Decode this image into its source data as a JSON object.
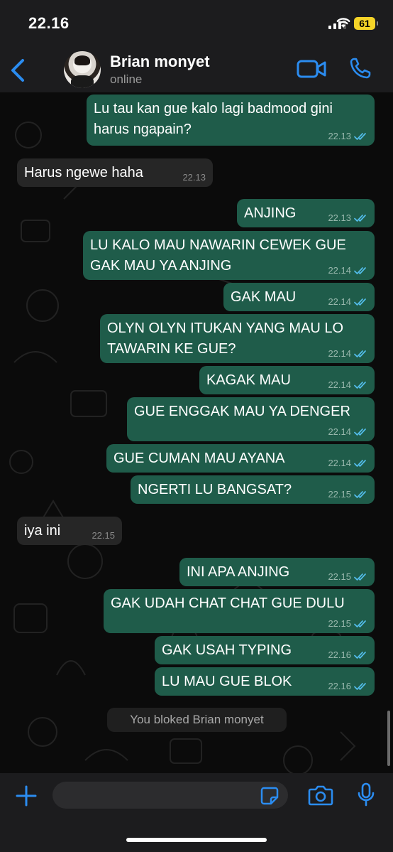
{
  "status_bar": {
    "time": "22.16",
    "battery": "61"
  },
  "header": {
    "name": "Brian monyet",
    "status": "online"
  },
  "messages": [
    {
      "dir": "out",
      "text": "Lu tau kan gue kalo lagi badmood gini harus ngapain?",
      "time": "22.13",
      "read": true
    },
    {
      "dir": "in",
      "text": "Harus ngewe haha",
      "time": "22.13"
    },
    {
      "dir": "out",
      "text": "ANJING",
      "time": "22.13",
      "read": true
    },
    {
      "dir": "out",
      "text": "LU KALO MAU NAWARIN CEWEK GUE GAK MAU YA ANJING",
      "time": "22.14",
      "read": true
    },
    {
      "dir": "out",
      "text": "GAK MAU",
      "time": "22.14",
      "read": true
    },
    {
      "dir": "out",
      "text": "OLYN OLYN ITUKAN YANG MAU LO TAWARIN KE GUE?",
      "time": "22.14",
      "read": true
    },
    {
      "dir": "out",
      "text": "KAGAK MAU",
      "time": "22.14",
      "read": true
    },
    {
      "dir": "out",
      "text": "GUE ENGGAK MAU YA DENGER",
      "time": "22.14",
      "read": true
    },
    {
      "dir": "out",
      "text": "GUE CUMAN MAU AYANA",
      "time": "22.14",
      "read": true
    },
    {
      "dir": "out",
      "text": "NGERTI LU BANGSAT?",
      "time": "22.15",
      "read": true
    },
    {
      "dir": "in",
      "text": "iya ini",
      "time": "22.15"
    },
    {
      "dir": "out",
      "text": "INI APA ANJING",
      "time": "22.15",
      "read": true
    },
    {
      "dir": "out",
      "text": "GAK UDAH CHAT CHAT GUE DULU",
      "time": "22.15",
      "read": true
    },
    {
      "dir": "out",
      "text": "GAK USAH TYPING",
      "time": "22.16",
      "read": true
    },
    {
      "dir": "out",
      "text": "LU MAU GUE BLOK",
      "time": "22.16",
      "read": true
    }
  ],
  "system_notice": "You bloked Brian monyet",
  "composer": {
    "value": ""
  },
  "colors": {
    "outgoing": "#1f5c4a",
    "incoming": "#262626",
    "accent": "#2b8cf0",
    "read_ticks": "#53bdeb"
  }
}
